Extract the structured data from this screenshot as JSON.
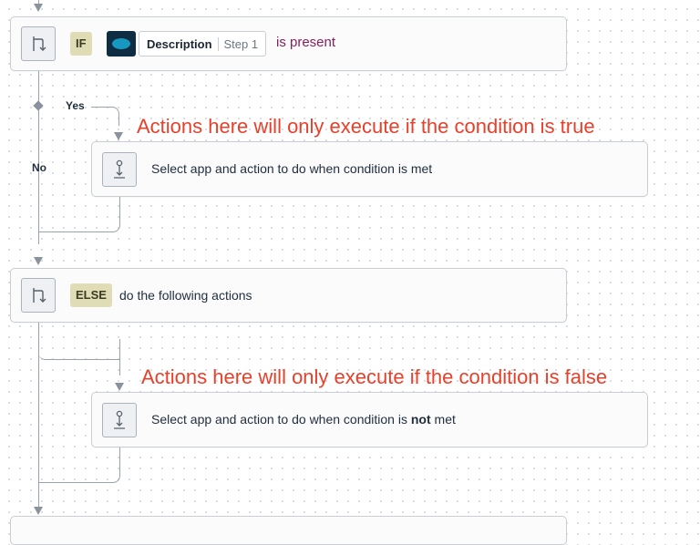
{
  "if_block": {
    "keyword": "IF",
    "field_name": "Description",
    "field_step": "Step 1",
    "condition": "is present"
  },
  "branches": {
    "yes_label": "Yes",
    "no_label": "No"
  },
  "true_action": {
    "annotation": "Actions here will only execute if the condition is true",
    "text": "Select app and action to do when condition is met"
  },
  "else_block": {
    "keyword": "ELSE",
    "text": "do the following actions"
  },
  "false_action": {
    "annotation": "Actions here will only execute if the condition is false",
    "text_before": "Select app and action to do when condition is ",
    "text_bold": "not",
    "text_after": " met"
  },
  "colors": {
    "annotation": "#e8402a",
    "keyword_bg": "#dfdcb6",
    "condition_text": "#8a1e5c",
    "connector": "#9aa3ad"
  },
  "icons": {
    "branch": "branch-flow-icon",
    "action": "action-step-icon",
    "app": "salesforce-logo"
  }
}
